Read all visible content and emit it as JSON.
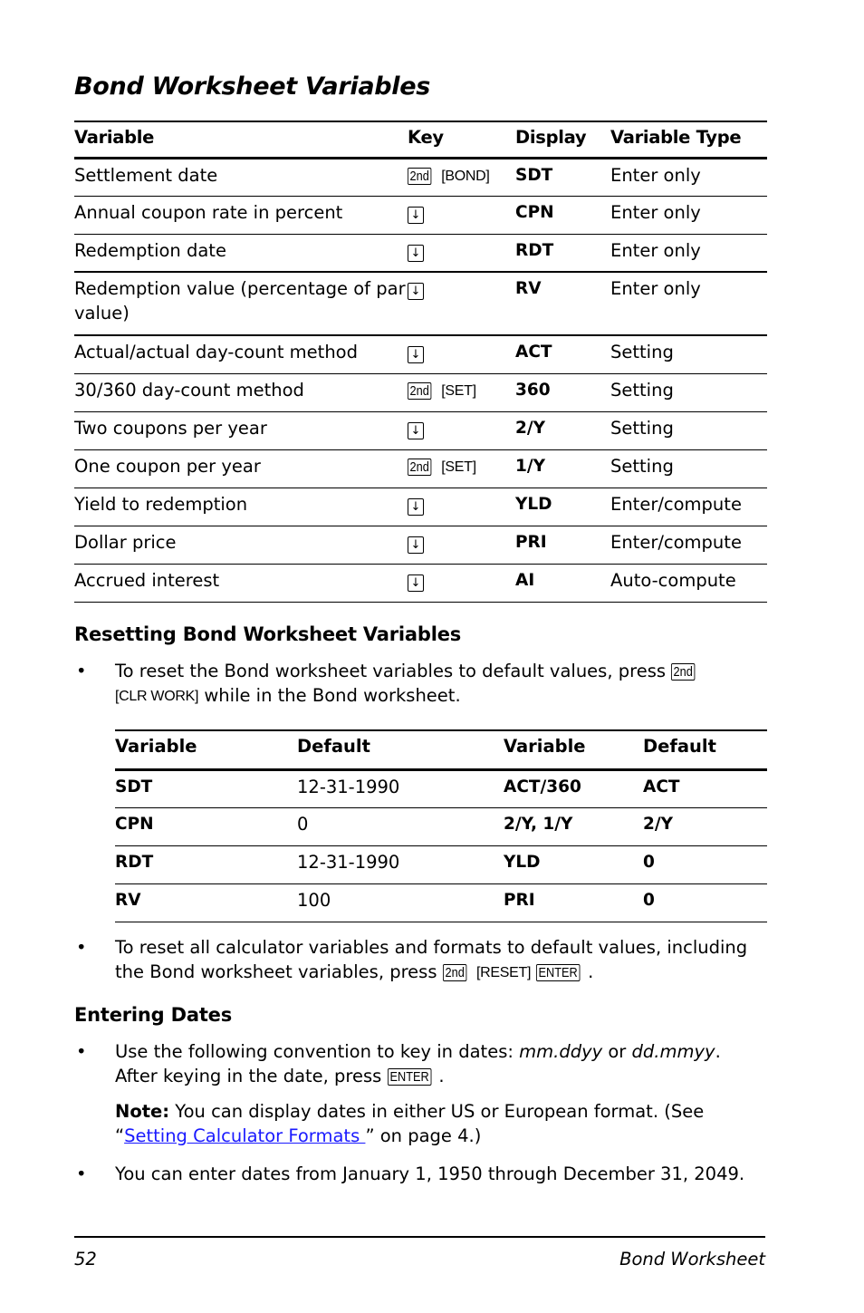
{
  "title": "Bond Worksheet Variables",
  "variables_table": {
    "headers": [
      "Variable",
      "Key",
      "Display",
      "Variable Type"
    ],
    "rows": [
      {
        "variable": "Settlement date",
        "key": {
          "type": "2nd",
          "primary": "2nd",
          "secondary": "BOND"
        },
        "display": "SDT",
        "var_type": "Enter only"
      },
      {
        "variable": "Annual coupon rate in percent",
        "key": {
          "type": "arrow",
          "icon": "down-arrow-key"
        },
        "display": "CPN",
        "var_type": "Enter only"
      },
      {
        "variable": "Redemption date",
        "key": {
          "type": "arrow",
          "icon": "down-arrow-key"
        },
        "display": "RDT",
        "var_type": "Enter only"
      },
      {
        "variable": "Redemption value (percentage of par value)",
        "key": {
          "type": "arrow",
          "icon": "down-arrow-key"
        },
        "display": "RV",
        "var_type": "Enter only"
      },
      {
        "variable": "Actual/actual day-count method",
        "key": {
          "type": "arrow",
          "icon": "down-arrow-key"
        },
        "display": "ACT",
        "var_type": "Setting"
      },
      {
        "variable": "30/360 day-count method",
        "key": {
          "type": "2nd",
          "primary": "2nd",
          "secondary": "SET"
        },
        "display": "360",
        "var_type": "Setting"
      },
      {
        "variable": "Two coupons per year",
        "key": {
          "type": "arrow",
          "icon": "down-arrow-key"
        },
        "display": "2/Y",
        "var_type": "Setting"
      },
      {
        "variable": "One coupon per year",
        "key": {
          "type": "2nd",
          "primary": "2nd",
          "secondary": "SET"
        },
        "display": "1/Y",
        "var_type": "Setting"
      },
      {
        "variable": "Yield to redemption",
        "key": {
          "type": "arrow",
          "icon": "down-arrow-key"
        },
        "display": "YLD",
        "var_type": "Enter/compute"
      },
      {
        "variable": "Dollar price",
        "key": {
          "type": "arrow",
          "icon": "down-arrow-key"
        },
        "display": "PRI",
        "var_type": "Enter/compute"
      },
      {
        "variable": "Accrued interest",
        "key": {
          "type": "arrow",
          "icon": "down-arrow-key"
        },
        "display": "AI",
        "var_type": "Auto-compute"
      }
    ]
  },
  "resetting": {
    "heading": "Resetting Bond Worksheet Variables",
    "bullet1": {
      "text_before": "To reset the Bond worksheet variables to default values, press",
      "key_primary": "2nd",
      "key_secondary": "CLR WORK",
      "text_after": "while in the Bond worksheet."
    },
    "defaults_table": {
      "headers": [
        "Variable",
        "Default",
        "Variable",
        "Default"
      ],
      "rows": [
        [
          "SDT",
          "12-31-1990",
          "ACT/360",
          "ACT"
        ],
        [
          "CPN",
          "0",
          "2/Y, 1/Y",
          "2/Y"
        ],
        [
          "RDT",
          "12-31-1990",
          "YLD",
          "0"
        ],
        [
          "RV",
          "100",
          "PRI",
          "0"
        ]
      ]
    },
    "bullet2": {
      "text_before": "To reset all calculator variables and formats to default values, including the Bond worksheet variables, press",
      "key_primary": "2nd",
      "key_secondary": "RESET",
      "key_enter": "ENTER",
      "text_after": "."
    }
  },
  "entering_dates": {
    "heading": "Entering Dates",
    "bullet1": {
      "text_before": "Use the following convention to key in dates:",
      "format_us": "mm.ddyy",
      "or": "or",
      "format_eu": "dd.mmyy",
      "text_mid": ". After keying in the date, press",
      "key_enter": "ENTER",
      "text_after": "."
    },
    "note": {
      "label": "Note:",
      "text_before": "You can display dates in either US or European format. (See “",
      "link_text": "Setting Calculator Formats ",
      "text_after": "” on page 4.)",
      "link_color": "#1a1aff"
    },
    "bullet2": "You can enter dates from January 1, 1950 through December 31, 2049."
  },
  "footer": {
    "page_number": "52",
    "section": "Bond Worksheet"
  },
  "bullet_char": "•",
  "down_arrow_glyph": "↓"
}
